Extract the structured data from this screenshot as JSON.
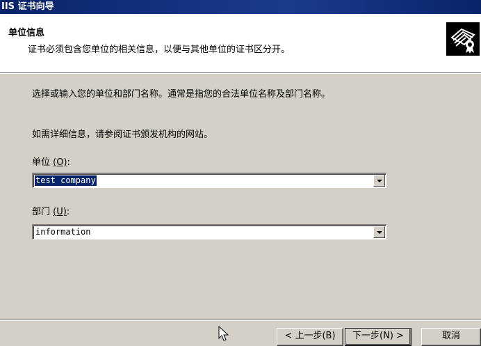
{
  "window": {
    "title": "IIS 证书向导"
  },
  "header": {
    "title": "单位信息",
    "description": "证书必须包含您单位的相关信息，以便与其他单位的证书区分开。"
  },
  "body": {
    "instruction1": "选择或输入您的单位和部门名称。通常是指您的合法单位名称及部门名称。",
    "instruction2": "如需详细信息，请参阅证书颁发机构的网站。"
  },
  "fields": {
    "organization": {
      "label": "单位",
      "accel": "(O)",
      "colon": ":",
      "value": "test company"
    },
    "department": {
      "label": "部门",
      "accel": "(U)",
      "colon": ":",
      "value": "information"
    }
  },
  "buttons": {
    "back": "< 上一步(B)",
    "next": "下一步(N) >",
    "cancel": "取消"
  },
  "colors": {
    "titlebar": "#0a246a",
    "dialog": "#d4d0c8",
    "selection": "#0a246a"
  }
}
